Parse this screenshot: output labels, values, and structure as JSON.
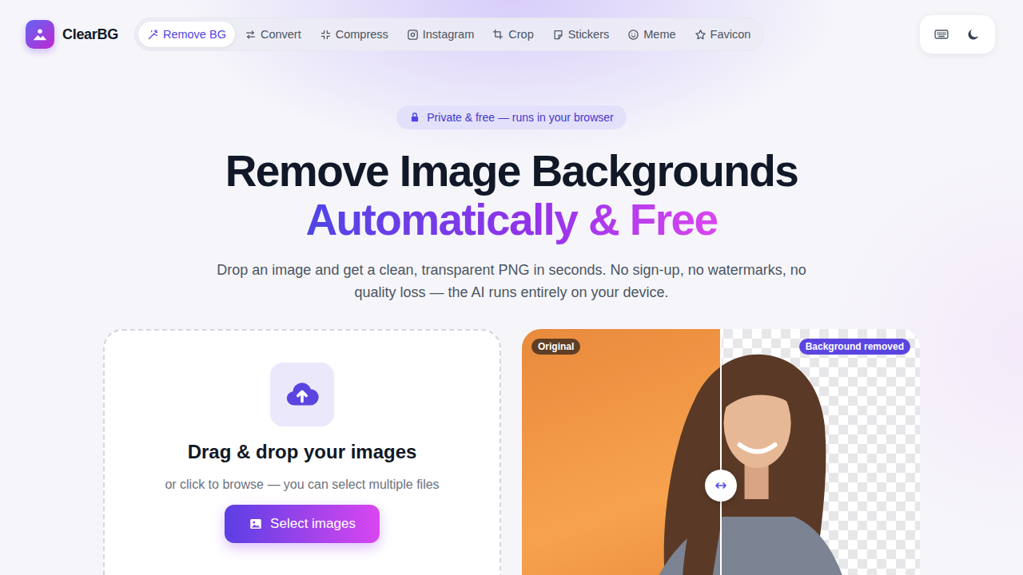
{
  "brand": {
    "name": "ClearBG"
  },
  "nav": [
    {
      "label": "Remove BG",
      "selected": true
    },
    {
      "label": "Convert",
      "selected": false
    },
    {
      "label": "Compress",
      "selected": false
    },
    {
      "label": "Instagram",
      "selected": false
    },
    {
      "label": "Crop",
      "selected": false
    },
    {
      "label": "Stickers",
      "selected": false
    },
    {
      "label": "Meme",
      "selected": false
    },
    {
      "label": "Favicon",
      "selected": false
    }
  ],
  "hero": {
    "badge": "Private & free — runs in your browser",
    "title": "Remove Image Backgrounds",
    "highlight": "Automatically & Free",
    "subtitle": "Drop an image and get a clean, transparent PNG in seconds. No sign-up, no watermarks, no quality loss — the AI runs entirely on your device."
  },
  "dropzone": {
    "title": "Drag & drop your images",
    "hint": "or click to browse — you can select multiple files",
    "button": "Select images"
  },
  "comparison": {
    "before_label": "Original",
    "after_label": "Background removed",
    "level": 0.5
  }
}
